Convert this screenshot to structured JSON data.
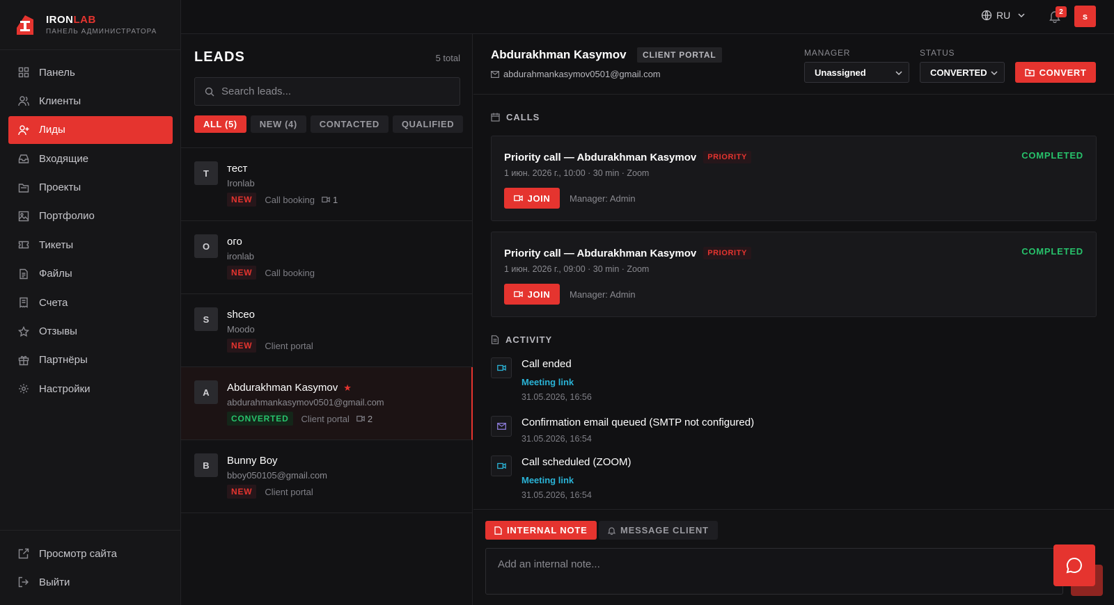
{
  "brand": {
    "name_main": "IRON",
    "name_accent": "LAB",
    "subtitle": "ПАНЕЛЬ АДМИНИСТРАТОРА"
  },
  "sidebar": {
    "items": [
      {
        "label": "Панель",
        "icon": "dashboard-icon"
      },
      {
        "label": "Клиенты",
        "icon": "users-icon"
      },
      {
        "label": "Лиды",
        "icon": "user-plus-icon",
        "active": true
      },
      {
        "label": "Входящие",
        "icon": "inbox-icon"
      },
      {
        "label": "Проекты",
        "icon": "folder-icon"
      },
      {
        "label": "Портфолио",
        "icon": "image-icon"
      },
      {
        "label": "Тикеты",
        "icon": "ticket-icon"
      },
      {
        "label": "Файлы",
        "icon": "file-icon"
      },
      {
        "label": "Счета",
        "icon": "receipt-icon"
      },
      {
        "label": "Отзывы",
        "icon": "star-icon"
      },
      {
        "label": "Партнёры",
        "icon": "gift-icon"
      },
      {
        "label": "Настройки",
        "icon": "gear-icon"
      }
    ],
    "bottom": [
      {
        "label": "Просмотр сайта",
        "icon": "external-link-icon"
      },
      {
        "label": "Выйти",
        "icon": "logout-icon"
      }
    ]
  },
  "topbar": {
    "language": "RU",
    "notifications": "2",
    "user_initial": "s"
  },
  "leads": {
    "title": "LEADS",
    "total": "5 total",
    "search_placeholder": "Search leads...",
    "filters": [
      "ALL (5)",
      "NEW (4)",
      "CONTACTED",
      "QUALIFIED"
    ],
    "items": [
      {
        "initial": "T",
        "name": "тест",
        "sub": "Ironlab",
        "status": "NEW",
        "source": "Call booking",
        "calls": "1"
      },
      {
        "initial": "O",
        "name": "ого",
        "sub": "ironlab",
        "status": "NEW",
        "source": "Call booking"
      },
      {
        "initial": "S",
        "name": "shceo",
        "sub": "Moodo",
        "status": "NEW",
        "source": "Client portal"
      },
      {
        "initial": "A",
        "name": "Abdurakhman Kasymov",
        "sub": "abdurahmankasymov0501@gmail.com",
        "status": "CONVERTED",
        "source": "Client portal",
        "calls": "2"
      },
      {
        "initial": "B",
        "name": "Bunny Boy",
        "sub": "bboy050105@gmail.com",
        "status": "NEW",
        "source": "Client portal"
      }
    ]
  },
  "detail": {
    "name": "Abdurakhman Kasymov",
    "source_badge": "CLIENT PORTAL",
    "email": "abdurahmankasymov0501@gmail.com",
    "manager_label": "MANAGER",
    "manager_value": "Unassigned",
    "status_label": "STATUS",
    "status_value": "CONVERTED",
    "convert_label": "CONVERT",
    "calls_title": "CALLS",
    "calls": [
      {
        "title": "Priority call — Abdurakhman Kasymov",
        "priority": "PRIORITY",
        "status": "COMPLETED",
        "info": "1 июн. 2026 г., 10:00 · 30 min · Zoom",
        "join": "JOIN",
        "manager": "Manager: Admin"
      },
      {
        "title": "Priority call — Abdurakhman Kasymov",
        "priority": "PRIORITY",
        "status": "COMPLETED",
        "info": "1 июн. 2026 г., 09:00 · 30 min · Zoom",
        "join": "JOIN",
        "manager": "Manager: Admin"
      }
    ],
    "activity_title": "ACTIVITY",
    "activity": [
      {
        "icon": "video-icon",
        "title": "Call ended",
        "link": "Meeting link",
        "time": "31.05.2026, 16:56"
      },
      {
        "icon": "mail-icon",
        "title": "Confirmation email queued (SMTP not configured)",
        "time": "31.05.2026, 16:54"
      },
      {
        "icon": "video-icon",
        "title": "Call scheduled (ZOOM)",
        "link": "Meeting link",
        "time": "31.05.2026, 16:54"
      }
    ],
    "composer": {
      "tab_note": "INTERNAL NOTE",
      "tab_message": "MESSAGE CLIENT",
      "placeholder": "Add an internal note..."
    }
  },
  "colors": {
    "accent": "#e5342f",
    "success": "#27c26b",
    "link": "#2ab3d6",
    "background": "#111113"
  }
}
